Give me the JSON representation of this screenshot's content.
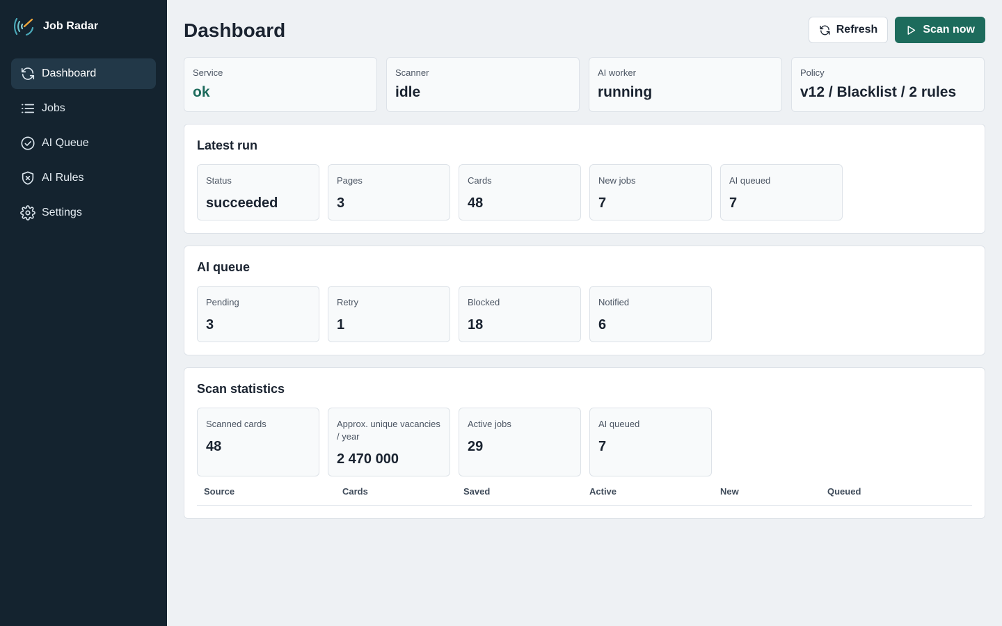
{
  "app": {
    "name": "Job Radar"
  },
  "sidebar": {
    "items": [
      {
        "label": "Dashboard",
        "icon": "refresh-icon",
        "active": true
      },
      {
        "label": "Jobs",
        "icon": "list-icon"
      },
      {
        "label": "AI Queue",
        "icon": "check-circle-icon"
      },
      {
        "label": "AI Rules",
        "icon": "shield-x-icon"
      },
      {
        "label": "Settings",
        "icon": "gear-icon"
      }
    ]
  },
  "header": {
    "title": "Dashboard",
    "refresh_label": "Refresh",
    "scan_label": "Scan now"
  },
  "summary": [
    {
      "label": "Service",
      "value": "ok"
    },
    {
      "label": "Scanner",
      "value": "idle"
    },
    {
      "label": "AI worker",
      "value": "running"
    },
    {
      "label": "Policy",
      "value": "v12 / Blacklist / 2 rules"
    }
  ],
  "latest_run": {
    "title": "Latest run",
    "metrics": [
      {
        "label": "Status",
        "value": "succeeded"
      },
      {
        "label": "Pages",
        "value": "3"
      },
      {
        "label": "Cards",
        "value": "48"
      },
      {
        "label": "New jobs",
        "value": "7"
      },
      {
        "label": "AI queued",
        "value": "7"
      }
    ]
  },
  "ai_queue": {
    "title": "AI queue",
    "metrics": [
      {
        "label": "Pending",
        "value": "3"
      },
      {
        "label": "Retry",
        "value": "1"
      },
      {
        "label": "Blocked",
        "value": "18"
      },
      {
        "label": "Notified",
        "value": "6"
      }
    ]
  },
  "scan_statistics": {
    "title": "Scan statistics",
    "metrics": [
      {
        "label": "Scanned cards",
        "value": "48"
      },
      {
        "label": "Approx. unique vacancies / year",
        "value": "2 470 000"
      },
      {
        "label": "Active jobs",
        "value": "29"
      },
      {
        "label": "AI queued",
        "value": "7"
      }
    ],
    "table_columns": [
      "Source",
      "Cards",
      "Saved",
      "Active",
      "New",
      "Queued"
    ]
  },
  "colors": {
    "sidebar_bg": "#14232f",
    "accent_green": "#1d6b5c",
    "retry_red": "#a3281b",
    "notified_teal": "#1a6470"
  }
}
